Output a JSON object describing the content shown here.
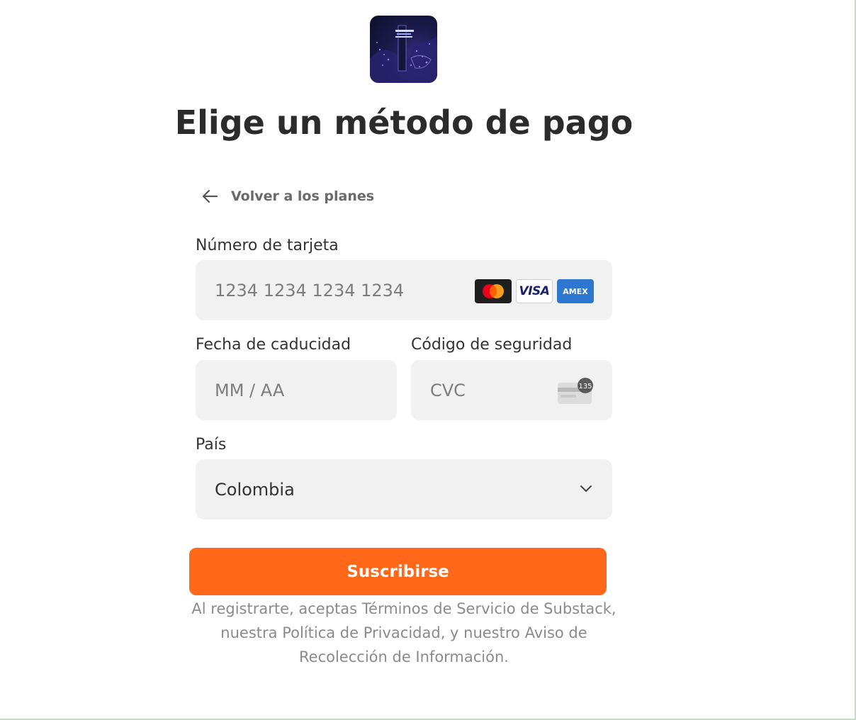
{
  "page": {
    "title": "Elige un método de pago",
    "back_link": "Volver a los planes"
  },
  "card_number": {
    "label": "Número de tarjeta",
    "placeholder": "1234 1234 1234 1234",
    "brands": [
      "mastercard",
      "VISA",
      "AMEX"
    ]
  },
  "expiry": {
    "label": "Fecha de caducidad",
    "placeholder": "MM / AA"
  },
  "cvc": {
    "label": "Código de seguridad",
    "placeholder": "CVC",
    "icon_badge": "135"
  },
  "country": {
    "label": "País",
    "value": "Colombia"
  },
  "submit": {
    "label": "Suscribirse"
  },
  "legal": {
    "prefix": "Al registrarte, aceptas ",
    "terms": "Términos de Servicio",
    "mid1": " de Substack, nuestra ",
    "privacy": "Política de Privacidad",
    "mid2": ", y nuestro ",
    "collection": "Aviso de Recolección de Información",
    "suffix": "."
  },
  "colors": {
    "accent": "#ff6719",
    "field_bg": "#f1f1f1",
    "text": "#2b2b2b",
    "muted": "#8a8a8a"
  }
}
